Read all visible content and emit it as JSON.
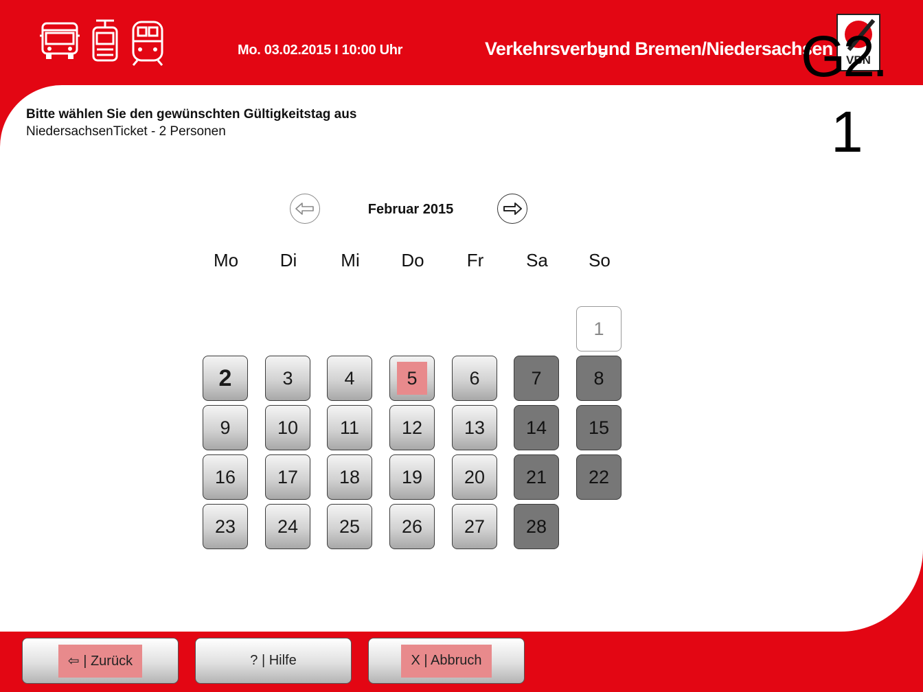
{
  "header": {
    "datetime": "Mo. 03.02.2015  I  10:00 Uhr",
    "brand": "Verkehrsverbund Bremen/Niedersachsen",
    "mini_overlay": "5",
    "logo_text": "VBN"
  },
  "overlay": {
    "code": "G2.",
    "number": "1"
  },
  "prompt": {
    "title": "Bitte wählen Sie den gewünschten Gültigkeitstag aus",
    "subtitle": "NiedersachsenTicket - 2 Personen"
  },
  "calendar": {
    "month_label": "Februar 2015",
    "weekdays": [
      "Mo",
      "Di",
      "Mi",
      "Do",
      "Fr",
      "Sa",
      "So"
    ],
    "days": [
      {
        "label": "1",
        "state": "disabled"
      },
      {
        "label": "2",
        "state": "today"
      },
      {
        "label": "3",
        "state": "normal"
      },
      {
        "label": "4",
        "state": "normal"
      },
      {
        "label": "5",
        "state": "marked"
      },
      {
        "label": "6",
        "state": "normal"
      },
      {
        "label": "7",
        "state": "weekend"
      },
      {
        "label": "8",
        "state": "weekend"
      },
      {
        "label": "9",
        "state": "normal"
      },
      {
        "label": "10",
        "state": "normal"
      },
      {
        "label": "11",
        "state": "normal"
      },
      {
        "label": "12",
        "state": "normal"
      },
      {
        "label": "13",
        "state": "normal"
      },
      {
        "label": "14",
        "state": "weekend"
      },
      {
        "label": "15",
        "state": "weekend"
      },
      {
        "label": "16",
        "state": "normal"
      },
      {
        "label": "17",
        "state": "normal"
      },
      {
        "label": "18",
        "state": "normal"
      },
      {
        "label": "19",
        "state": "normal"
      },
      {
        "label": "20",
        "state": "normal"
      },
      {
        "label": "21",
        "state": "weekend"
      },
      {
        "label": "22",
        "state": "weekend"
      },
      {
        "label": "23",
        "state": "normal"
      },
      {
        "label": "24",
        "state": "normal"
      },
      {
        "label": "25",
        "state": "normal"
      },
      {
        "label": "26",
        "state": "normal"
      },
      {
        "label": "27",
        "state": "normal"
      },
      {
        "label": "28",
        "state": "weekend"
      }
    ]
  },
  "footer": {
    "back_label": "⇦ | Zurück",
    "help_label": "? | Hilfe",
    "cancel_label": "X | Abbruch"
  },
  "colors": {
    "brand_red": "#e30613",
    "highlight": "#e88a8c",
    "weekend_gray": "#777777"
  }
}
